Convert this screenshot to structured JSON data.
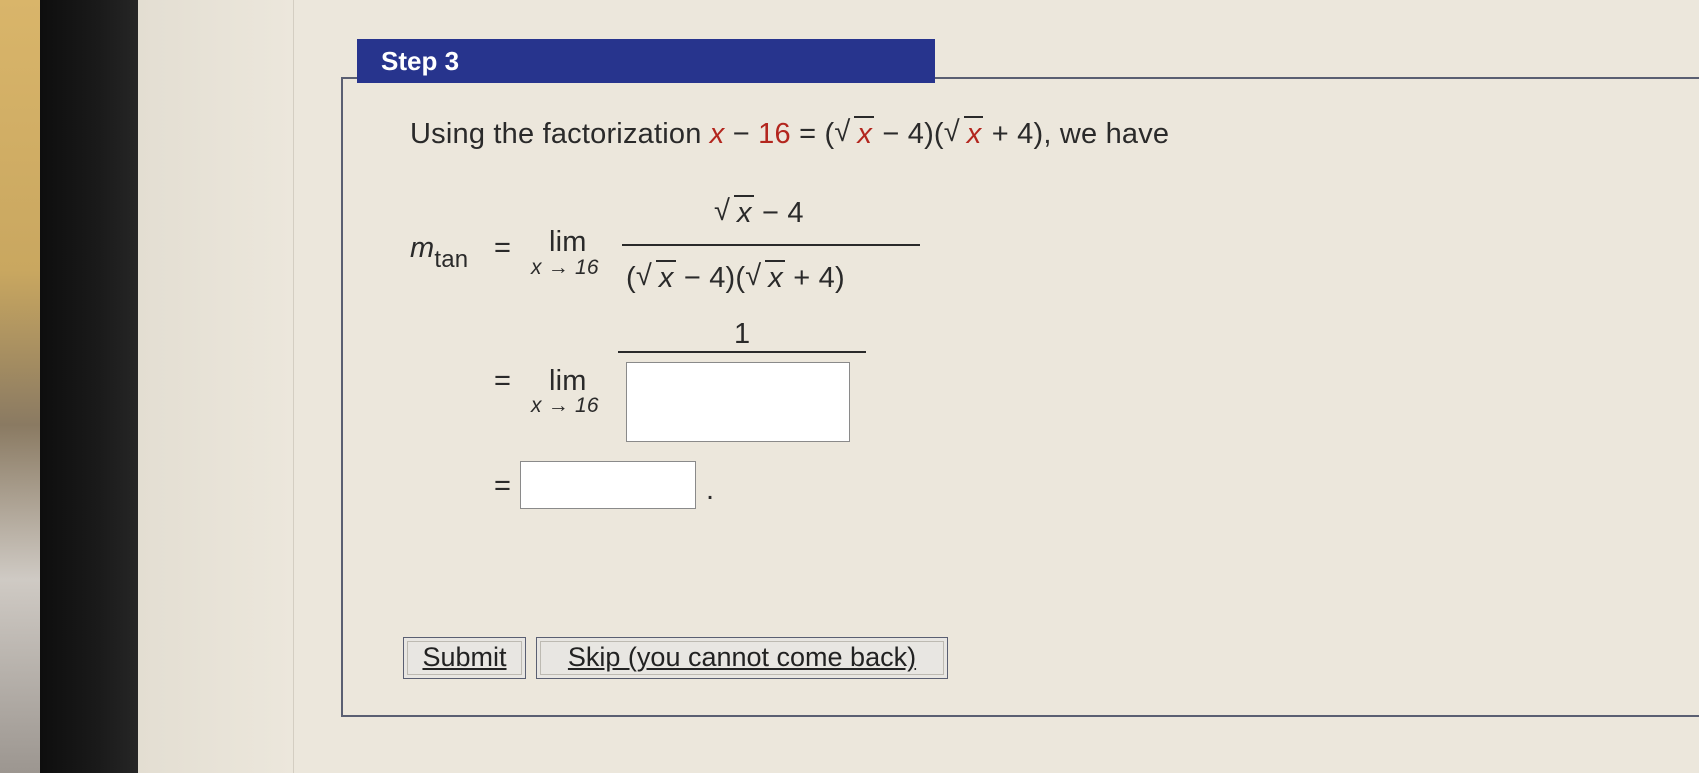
{
  "step": {
    "title": "Step 3"
  },
  "intro": {
    "prefix": "Using the factorization",
    "x": "x",
    "minus": "−",
    "sixteen": "16",
    "equals": "=",
    "open1": "(",
    "sqrt_x": "x",
    "minus4": "− 4)(",
    "sqrt_x2": "x",
    "plus4": "+ 4), we have"
  },
  "math": {
    "m": "m",
    "tan": "tan",
    "equals": "=",
    "lim": "lim",
    "lim_sub": "x → 16",
    "numerator_sqrt": "x",
    "numerator_rest": "− 4",
    "den_open": "(",
    "den_sqrt1": "x",
    "den_mid": "− 4)(",
    "den_sqrt2": "x",
    "den_end": "+ 4)",
    "one": "1",
    "period": "."
  },
  "buttons": {
    "submit": "Submit",
    "skip": "Skip (you cannot come back)"
  }
}
